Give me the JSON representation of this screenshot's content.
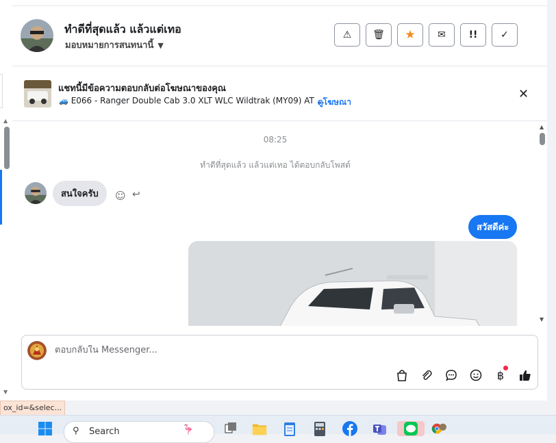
{
  "header": {
    "contact_name": "ทำดีที่สุดแล้ว แล้วแต่เทอ",
    "assign_label": "มอบหมายการสนทนานี้",
    "actions": [
      {
        "name": "report-button",
        "icon": "warning-icon",
        "glyph": "⚠"
      },
      {
        "name": "delete-button",
        "icon": "trash-icon",
        "glyph": "🗑"
      },
      {
        "name": "star-button",
        "icon": "star-icon",
        "glyph": "★"
      },
      {
        "name": "mark-unread-button",
        "icon": "envelope-icon",
        "glyph": "✉"
      },
      {
        "name": "priority-button",
        "icon": "exclamation-icon",
        "glyph": "!!"
      },
      {
        "name": "done-button",
        "icon": "check-icon",
        "glyph": "✓"
      }
    ]
  },
  "ad": {
    "title": "แชทนี้มีข้อความตอบกลับต่อโฆษณาของคุณ",
    "subtitle": "E066 - Ranger Double Cab 3.0 XLT WLC Wildtrak (MY09) AT ...",
    "link_label": "ดูโฆษณา",
    "close_icon": "close-icon"
  },
  "chat": {
    "timestamp": "08:25",
    "system_message": "ทำดีที่สุดแล้ว แล้วแต่เทอ ได้ตอบกลับโพสต์",
    "incoming_message": "สนใจครับ",
    "outgoing_message": "สวัสดีค่ะ"
  },
  "composer": {
    "placeholder": "ตอบกลับใน Messenger...",
    "tools": [
      {
        "name": "shop-button",
        "icon": "shopping-bag-icon",
        "glyph": "👜"
      },
      {
        "name": "attach-button",
        "icon": "paperclip-icon",
        "glyph": "📎"
      },
      {
        "name": "saved-replies-button",
        "icon": "chat-bubble-icon",
        "glyph": "💬"
      },
      {
        "name": "emoji-button",
        "icon": "smiley-icon",
        "glyph": "☺"
      },
      {
        "name": "payment-button",
        "icon": "baht-icon",
        "glyph": "฿"
      },
      {
        "name": "like-button",
        "icon": "thumbs-up-icon",
        "glyph": "👍"
      }
    ]
  },
  "status_url": "ox_id=&selec...",
  "taskbar": {
    "search_label": "Search"
  },
  "colors": {
    "accent": "#1877f2",
    "star": "#f28b1e",
    "notification_dot": "#f02849"
  }
}
